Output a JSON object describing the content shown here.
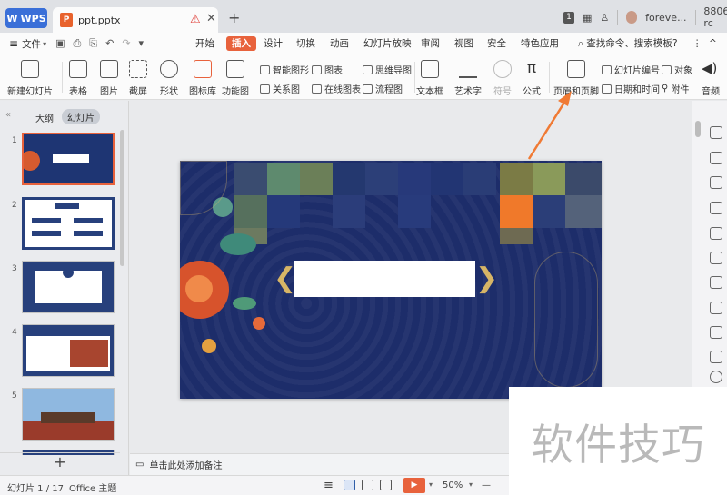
{
  "titlebar": {
    "app_label": "WPS",
    "doc_tab": "ppt.pptx",
    "new_tab": "+",
    "user_name": "foreve...",
    "right_text": "8806-rc",
    "badge": "1"
  },
  "menubar": {
    "hamburger": "≡",
    "file": "文件",
    "items": [
      "开始",
      "插入",
      "设计",
      "切换",
      "动画",
      "幻灯片放映",
      "审阅",
      "视图",
      "安全",
      "特色应用"
    ],
    "active": "插入",
    "search": "查找命令、搜索模板",
    "help": "?",
    "more": "⋮",
    "collapse": "^"
  },
  "ribbon": {
    "new_slide": "新建幻灯片",
    "table": "表格",
    "image": "图片",
    "screenshot": "截屏",
    "shape": "形状",
    "icon_lib": "图标库",
    "function_chart": "功能图",
    "smart_shape": "智能图形",
    "relation": "关系图",
    "chart": "图表",
    "online_chart": "在线图表",
    "mind_map": "思维导图",
    "flow_chart": "流程图",
    "textbox": "文本框",
    "art_text": "艺术字",
    "symbol": "符号",
    "formula": "公式",
    "header_footer": "页眉和页脚",
    "slide_number": "幻灯片编号",
    "object": "对象",
    "date_time": "日期和时间",
    "attachment": "附件",
    "audio": "音频"
  },
  "leftpanel": {
    "outline": "大纲",
    "slides": "幻灯片",
    "slide_numbers": [
      "1",
      "2",
      "3",
      "4",
      "5"
    ],
    "add": "+"
  },
  "notes": {
    "placeholder": "单击此处添加备注"
  },
  "statusbar": {
    "slide_info": "幻灯片 1 / 17",
    "theme": "Office 主题",
    "notes_toggle": "≡",
    "zoom": "50%",
    "zoom_minus": "—"
  },
  "watermark": "软件技巧",
  "colors": {
    "accent": "#e8623c",
    "wps_blue": "#3a6fd8",
    "slide_navy": "#1d2d6a",
    "banner_gold": "#d7b566"
  }
}
